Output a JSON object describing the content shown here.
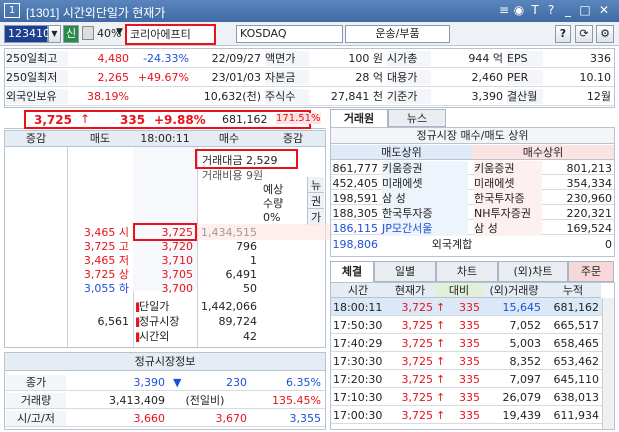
{
  "window": {
    "number": "1",
    "title": "[1301] 시간외단일가 현재가",
    "icons": [
      "link-icon",
      "pin-icon",
      "text-size-icon",
      "help-icon",
      "minimize-icon",
      "maximize-icon",
      "close-icon"
    ],
    "icon_glyphs": [
      "≡",
      "◉",
      "T",
      "?",
      "_",
      "□",
      "✕"
    ]
  },
  "toolbar": {
    "code": "123410",
    "search_label": "신",
    "percent": "40%",
    "name": "코리아에프티",
    "market": "KOSDAQ",
    "sector": "운송/부품",
    "help": "?"
  },
  "info": {
    "rows": [
      {
        "l1": "250일최고",
        "v1": "4,480",
        "v2": "-24.33%",
        "d": "22/09/27",
        "l2": "액면가",
        "v3": "100 원",
        "l3": "시가총",
        "v4": "944 억",
        "l4": "EPS",
        "v5": "336"
      },
      {
        "l1": "250일최저",
        "v1": "2,265",
        "v2": "+49.67%",
        "d": "23/01/03",
        "l2": "자본금",
        "v3": "28 억",
        "l3": "대용가",
        "v4": "2,460",
        "l4": "PER",
        "v5": "10.10"
      },
      {
        "l1": "외국인보유",
        "v1": "38.19%",
        "v2": "",
        "d": "10,632(천)",
        "l2": "주식수",
        "v3": "27,841 천",
        "l3": "기준가",
        "v4": "3,390",
        "l4": "결산월",
        "v5": "12월"
      }
    ]
  },
  "price": {
    "current": "3,725",
    "change": "335",
    "rate": "+9.88%",
    "volume": "681,162",
    "ratio": "171.51%"
  },
  "orderbook": {
    "headers": [
      "증감",
      "매도",
      "18:00:11",
      "매수",
      "증감"
    ],
    "amount_label": "거래대금 2,529",
    "cost_label": "거래비용 9원",
    "expect_label": "예상",
    "qty_label": "수량",
    "pct": "0%",
    "side_tabs": [
      "뉴",
      "권",
      "가"
    ],
    "rows": [
      {
        "left": "3,465 시",
        "price": "3,725",
        "right": "1,434,515"
      },
      {
        "left": "3,725 고",
        "price": "3,720",
        "right": "796"
      },
      {
        "left": "3,465 저",
        "price": "3,710",
        "right": "1"
      },
      {
        "left": "3,725 상",
        "price": "3,705",
        "right": "6,491"
      },
      {
        "left": "3,055 하",
        "price": "3,700",
        "right": "50"
      }
    ],
    "summary": [
      {
        "label": "단일가",
        "value": "1,442,066"
      },
      {
        "label": "정규시장",
        "value": "89,724",
        "left": "6,561"
      },
      {
        "label": "시간외",
        "value": "42"
      }
    ]
  },
  "regular": {
    "title": "정규시장정보",
    "rows": [
      {
        "label": "종가",
        "v1": "3,390",
        "arrow": "▼",
        "v2": "230",
        "v3": "6.35%"
      },
      {
        "label": "거래량",
        "v1": "3,413,409",
        "v2": "(전일비)",
        "v3": "135.45%"
      },
      {
        "label": "시/고/저",
        "v1": "3,660",
        "v2": "3,670",
        "v3": "3,355"
      }
    ]
  },
  "broker": {
    "tabs": [
      "거래원",
      "뉴스"
    ],
    "title": "정규시장 매수/매도 상위",
    "col1": "매도상위",
    "col2": "매수상위",
    "rows": [
      {
        "s": "861,777",
        "sn": "키움증권",
        "bn": "키움증권",
        "b": "801,213"
      },
      {
        "s": "452,405",
        "sn": "미래에셋",
        "bn": "미래에셋",
        "b": "354,334"
      },
      {
        "s": "198,591",
        "sn": "삼   성",
        "bn": "한국투자증",
        "b": "230,960"
      },
      {
        "s": "188,305",
        "sn": "한국투자증",
        "bn": "NH투자증권",
        "b": "220,321"
      },
      {
        "s": "186,115",
        "sn": "JP모간서울",
        "bn": "삼   성",
        "b": "169,524"
      }
    ],
    "foreign": {
      "value": "198,806",
      "label": "외국계합",
      "right": "0"
    }
  },
  "trades": {
    "tabs": [
      "체결",
      "일별",
      "차트",
      "(외)차트",
      "주문"
    ],
    "headers": [
      "시간",
      "현재가",
      "대비",
      "(외)거래량",
      "누적"
    ],
    "rows": [
      {
        "t": "18:00:11",
        "p": "3,725",
        "c": "335",
        "v": "15,645",
        "a": "681,162"
      },
      {
        "t": "17:50:30",
        "p": "3,725",
        "c": "335",
        "v": "7,052",
        "a": "665,517"
      },
      {
        "t": "17:40:29",
        "p": "3,725",
        "c": "335",
        "v": "5,003",
        "a": "658,465"
      },
      {
        "t": "17:30:30",
        "p": "3,725",
        "c": "335",
        "v": "8,352",
        "a": "653,462"
      },
      {
        "t": "17:20:30",
        "p": "3,725",
        "c": "335",
        "v": "7,097",
        "a": "645,110"
      },
      {
        "t": "17:10:30",
        "p": "3,725",
        "c": "335",
        "v": "26,079",
        "a": "638,013"
      },
      {
        "t": "17:00:30",
        "p": "3,725",
        "c": "335",
        "v": "19,439",
        "a": "611,934"
      }
    ]
  }
}
